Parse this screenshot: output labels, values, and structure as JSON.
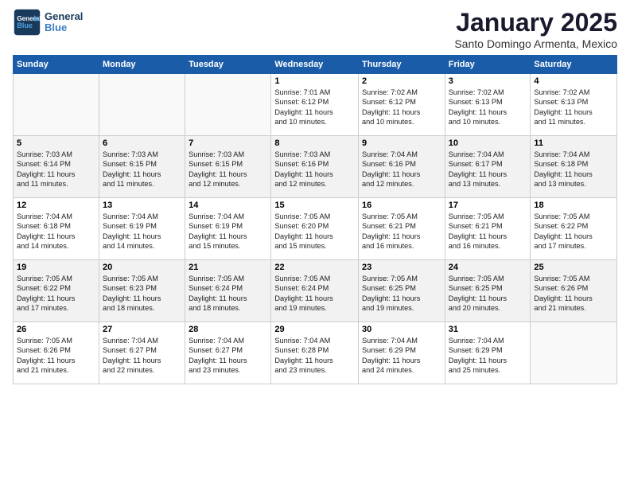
{
  "header": {
    "logo_line1": "General",
    "logo_line2": "Blue",
    "month": "January 2025",
    "location": "Santo Domingo Armenta, Mexico"
  },
  "weekdays": [
    "Sunday",
    "Monday",
    "Tuesday",
    "Wednesday",
    "Thursday",
    "Friday",
    "Saturday"
  ],
  "weeks": [
    [
      {
        "day": "",
        "info": ""
      },
      {
        "day": "",
        "info": ""
      },
      {
        "day": "",
        "info": ""
      },
      {
        "day": "1",
        "info": "Sunrise: 7:01 AM\nSunset: 6:12 PM\nDaylight: 11 hours\nand 10 minutes."
      },
      {
        "day": "2",
        "info": "Sunrise: 7:02 AM\nSunset: 6:12 PM\nDaylight: 11 hours\nand 10 minutes."
      },
      {
        "day": "3",
        "info": "Sunrise: 7:02 AM\nSunset: 6:13 PM\nDaylight: 11 hours\nand 10 minutes."
      },
      {
        "day": "4",
        "info": "Sunrise: 7:02 AM\nSunset: 6:13 PM\nDaylight: 11 hours\nand 11 minutes."
      }
    ],
    [
      {
        "day": "5",
        "info": "Sunrise: 7:03 AM\nSunset: 6:14 PM\nDaylight: 11 hours\nand 11 minutes."
      },
      {
        "day": "6",
        "info": "Sunrise: 7:03 AM\nSunset: 6:15 PM\nDaylight: 11 hours\nand 11 minutes."
      },
      {
        "day": "7",
        "info": "Sunrise: 7:03 AM\nSunset: 6:15 PM\nDaylight: 11 hours\nand 12 minutes."
      },
      {
        "day": "8",
        "info": "Sunrise: 7:03 AM\nSunset: 6:16 PM\nDaylight: 11 hours\nand 12 minutes."
      },
      {
        "day": "9",
        "info": "Sunrise: 7:04 AM\nSunset: 6:16 PM\nDaylight: 11 hours\nand 12 minutes."
      },
      {
        "day": "10",
        "info": "Sunrise: 7:04 AM\nSunset: 6:17 PM\nDaylight: 11 hours\nand 13 minutes."
      },
      {
        "day": "11",
        "info": "Sunrise: 7:04 AM\nSunset: 6:18 PM\nDaylight: 11 hours\nand 13 minutes."
      }
    ],
    [
      {
        "day": "12",
        "info": "Sunrise: 7:04 AM\nSunset: 6:18 PM\nDaylight: 11 hours\nand 14 minutes."
      },
      {
        "day": "13",
        "info": "Sunrise: 7:04 AM\nSunset: 6:19 PM\nDaylight: 11 hours\nand 14 minutes."
      },
      {
        "day": "14",
        "info": "Sunrise: 7:04 AM\nSunset: 6:19 PM\nDaylight: 11 hours\nand 15 minutes."
      },
      {
        "day": "15",
        "info": "Sunrise: 7:05 AM\nSunset: 6:20 PM\nDaylight: 11 hours\nand 15 minutes."
      },
      {
        "day": "16",
        "info": "Sunrise: 7:05 AM\nSunset: 6:21 PM\nDaylight: 11 hours\nand 16 minutes."
      },
      {
        "day": "17",
        "info": "Sunrise: 7:05 AM\nSunset: 6:21 PM\nDaylight: 11 hours\nand 16 minutes."
      },
      {
        "day": "18",
        "info": "Sunrise: 7:05 AM\nSunset: 6:22 PM\nDaylight: 11 hours\nand 17 minutes."
      }
    ],
    [
      {
        "day": "19",
        "info": "Sunrise: 7:05 AM\nSunset: 6:22 PM\nDaylight: 11 hours\nand 17 minutes."
      },
      {
        "day": "20",
        "info": "Sunrise: 7:05 AM\nSunset: 6:23 PM\nDaylight: 11 hours\nand 18 minutes."
      },
      {
        "day": "21",
        "info": "Sunrise: 7:05 AM\nSunset: 6:24 PM\nDaylight: 11 hours\nand 18 minutes."
      },
      {
        "day": "22",
        "info": "Sunrise: 7:05 AM\nSunset: 6:24 PM\nDaylight: 11 hours\nand 19 minutes."
      },
      {
        "day": "23",
        "info": "Sunrise: 7:05 AM\nSunset: 6:25 PM\nDaylight: 11 hours\nand 19 minutes."
      },
      {
        "day": "24",
        "info": "Sunrise: 7:05 AM\nSunset: 6:25 PM\nDaylight: 11 hours\nand 20 minutes."
      },
      {
        "day": "25",
        "info": "Sunrise: 7:05 AM\nSunset: 6:26 PM\nDaylight: 11 hours\nand 21 minutes."
      }
    ],
    [
      {
        "day": "26",
        "info": "Sunrise: 7:05 AM\nSunset: 6:26 PM\nDaylight: 11 hours\nand 21 minutes."
      },
      {
        "day": "27",
        "info": "Sunrise: 7:04 AM\nSunset: 6:27 PM\nDaylight: 11 hours\nand 22 minutes."
      },
      {
        "day": "28",
        "info": "Sunrise: 7:04 AM\nSunset: 6:27 PM\nDaylight: 11 hours\nand 23 minutes."
      },
      {
        "day": "29",
        "info": "Sunrise: 7:04 AM\nSunset: 6:28 PM\nDaylight: 11 hours\nand 23 minutes."
      },
      {
        "day": "30",
        "info": "Sunrise: 7:04 AM\nSunset: 6:29 PM\nDaylight: 11 hours\nand 24 minutes."
      },
      {
        "day": "31",
        "info": "Sunrise: 7:04 AM\nSunset: 6:29 PM\nDaylight: 11 hours\nand 25 minutes."
      },
      {
        "day": "",
        "info": ""
      }
    ]
  ]
}
